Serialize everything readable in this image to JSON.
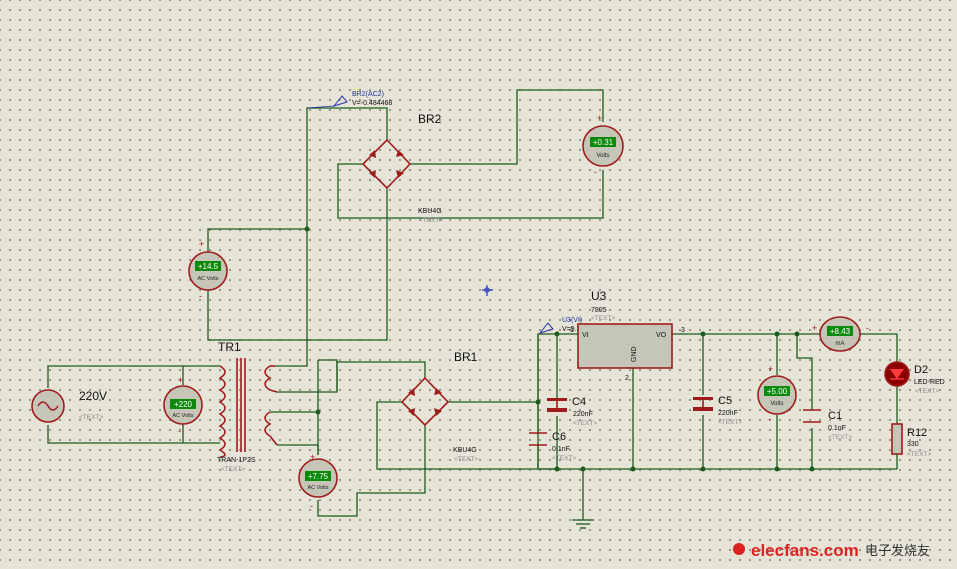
{
  "source": {
    "label": "220V",
    "placeholder": "<TEXT>"
  },
  "transformer": {
    "ref": "TR1",
    "part": "TRAN-1P2S",
    "placeholder": "<TEXT>"
  },
  "bridge_top": {
    "ref": "BR2",
    "part": "KBU4G",
    "placeholder": "<TEXT>"
  },
  "bridge_bottom": {
    "ref": "BR1",
    "part": "KBU4G",
    "placeholder": "<TEXT>"
  },
  "regulator": {
    "ref": "U3",
    "part": "7805",
    "placeholder": "<TEXT>",
    "pin_vi": "VI",
    "pin_vo": "VO",
    "pin_gnd": "GND",
    "pin1": "1",
    "pin2": "2",
    "pin3": "3"
  },
  "probe_top": {
    "name": "BR2(AC2)",
    "value": "V=-0.484468"
  },
  "probe_bottom": {
    "name": "U3(VI)",
    "value": "V=9.24757"
  },
  "meters": {
    "m_input": {
      "reading": "+220",
      "unit": "AC Volts"
    },
    "m_sec1": {
      "reading": "+14.5",
      "unit": "AC Volts"
    },
    "m_sec2": {
      "reading": "+7.75",
      "unit": "AC Volts"
    },
    "m_br2_out": {
      "reading": "+0.31",
      "unit": "Volts"
    },
    "m_out": {
      "reading": "+5.00",
      "unit": "Volts"
    },
    "m_current": {
      "reading": "+8.43",
      "unit": "mA"
    }
  },
  "capacitors": {
    "c4": {
      "ref": "C4",
      "value": "220nF",
      "placeholder": "<TEXT>"
    },
    "c6": {
      "ref": "C6",
      "value": "0.1nF",
      "placeholder": "<TEXT>"
    },
    "c5": {
      "ref": "C5",
      "value": "220nF",
      "placeholder": "<TEXT>"
    },
    "c1": {
      "ref": "C1",
      "value": "0.1nF",
      "placeholder": "<TEXT>"
    }
  },
  "led": {
    "ref": "D2",
    "part": "LED-RED",
    "placeholder": "<TEXT>"
  },
  "resistor": {
    "ref": "R12",
    "value": "330",
    "placeholder": "<TEXT>"
  },
  "watermark": {
    "site": "elecfans.com",
    "cn": "电子发烧友"
  },
  "colors": {
    "wire": "#1f5a1f",
    "component": "#a01c1c",
    "meter_display": "#0b8a0b",
    "background": "#e5e4d6"
  }
}
